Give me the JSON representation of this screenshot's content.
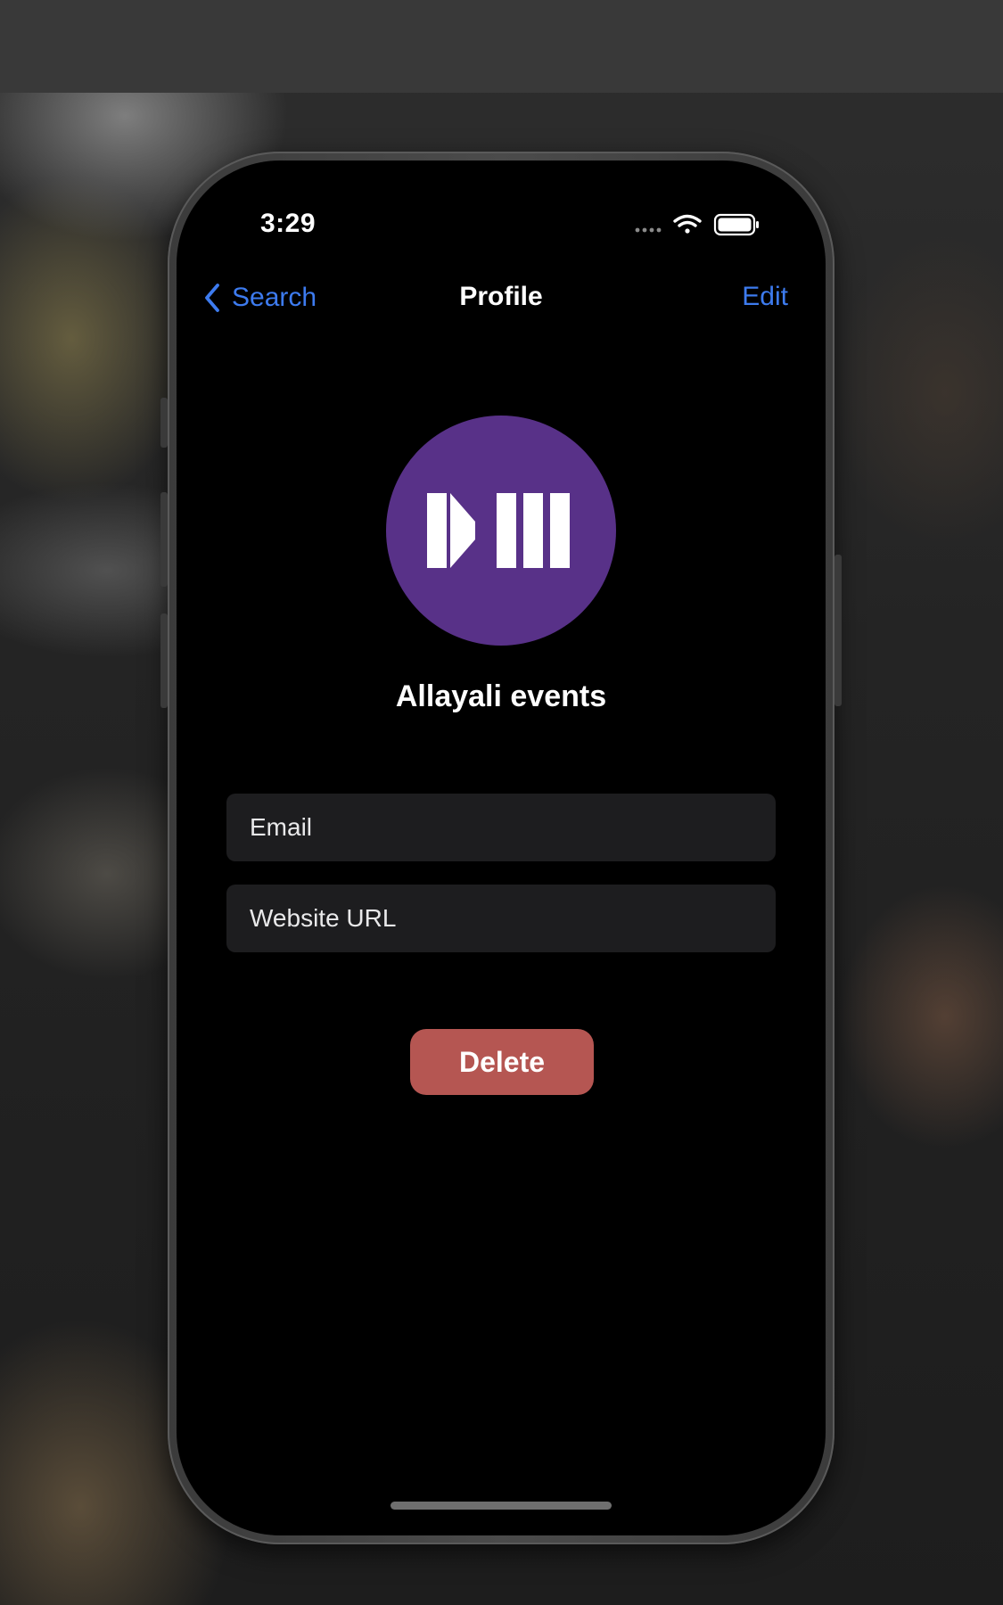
{
  "status_bar": {
    "time": "3:29"
  },
  "nav": {
    "back_label": "Search",
    "title": "Profile",
    "edit_label": "Edit"
  },
  "profile": {
    "name": "Allayali events",
    "avatar_color": "#583188"
  },
  "fields": {
    "email_placeholder": "Email",
    "website_placeholder": "Website URL"
  },
  "actions": {
    "delete_label": "Delete",
    "delete_color": "#b55652"
  },
  "colors": {
    "accent": "#3d7bef",
    "background": "#000000",
    "field_background": "#1d1d1f"
  },
  "icons": {
    "back": "chevron-left-icon",
    "signal": "cellular-signal-icon",
    "wifi": "wifi-icon",
    "battery": "battery-icon",
    "avatar_logo": "play-bars-logo-icon"
  }
}
